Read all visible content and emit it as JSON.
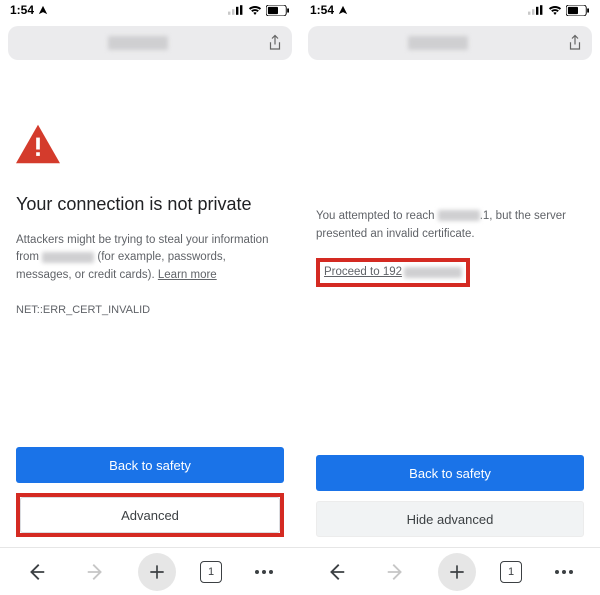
{
  "status": {
    "time": "1:54"
  },
  "left": {
    "title": "Your connection is not private",
    "desc_prefix": "Attackers might be trying to steal your information from ",
    "desc_suffix1": " (for example, passwords, messages, or credit cards). ",
    "learn_more": "Learn more",
    "error_code": "NET::ERR_CERT_INVALID",
    "back_btn": "Back to safety",
    "advanced_btn": "Advanced",
    "tab_count": "1"
  },
  "right": {
    "desc_prefix": "You attempted to reach ",
    "desc_mid": ".1, but the server presented an invalid certificate.",
    "proceed_prefix": "Proceed to 192",
    "back_btn": "Back to safety",
    "hide_btn": "Hide advanced",
    "tab_count": "1"
  }
}
